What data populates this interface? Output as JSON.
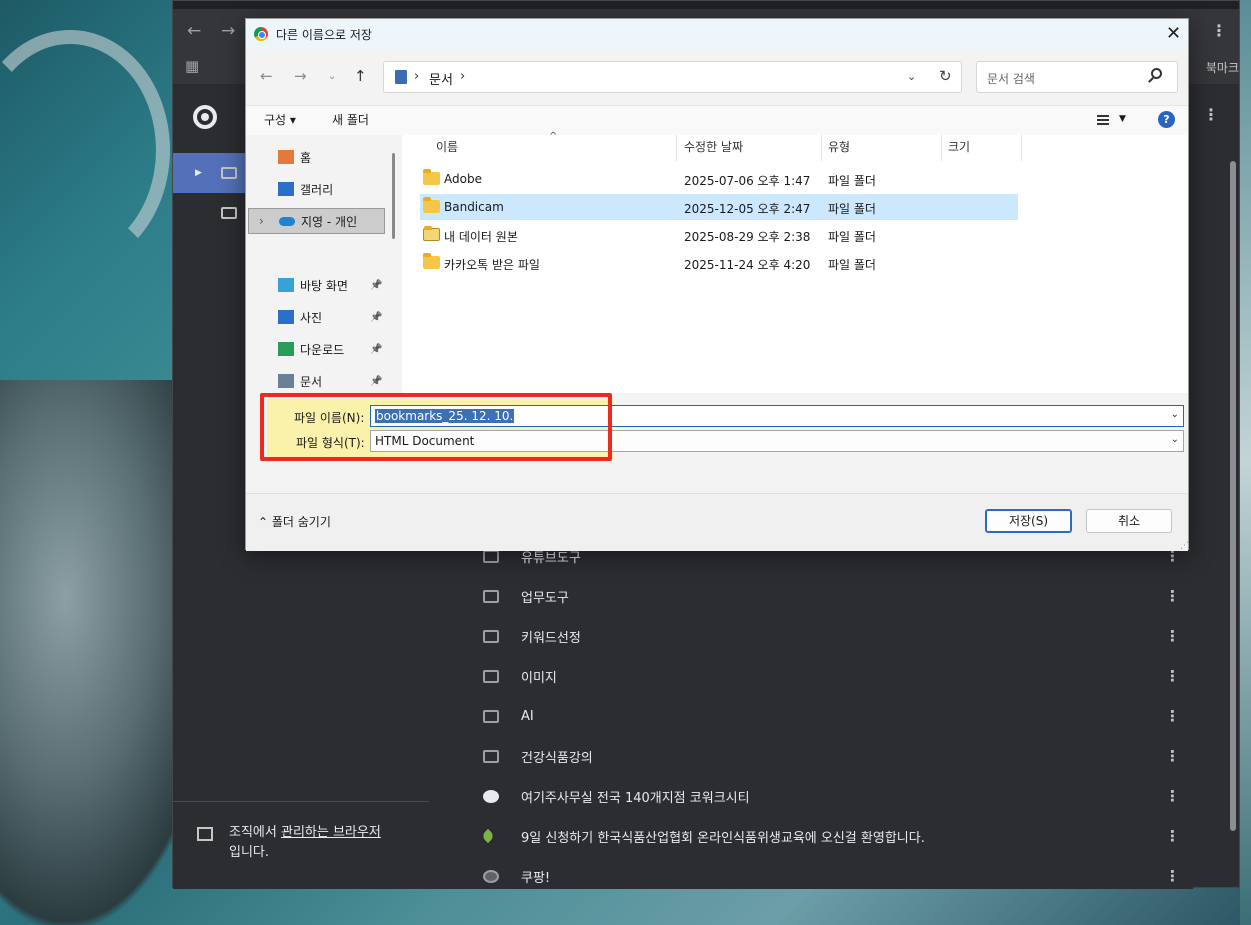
{
  "chrome": {
    "bookmarks_bar_label": "북마크",
    "org_text_prefix": "조직에서 ",
    "org_link": "관리하는 브라우저",
    "org_text_suffix": "입니다.",
    "bookmarks": [
      {
        "label": "유튜브도구",
        "icon": "folder-icon"
      },
      {
        "label": "업무도구",
        "icon": "folder-icon"
      },
      {
        "label": "키워드선정",
        "icon": "folder-icon"
      },
      {
        "label": "이미지",
        "icon": "folder-icon"
      },
      {
        "label": "AI",
        "icon": "folder-icon"
      },
      {
        "label": "건강식품강의",
        "icon": "folder-icon"
      },
      {
        "label": "여기주사무실 전국 140개지점 코워크시티",
        "icon": "site-c-icon"
      },
      {
        "label": "9일 신청하기 한국식품산업협회 온라인식품위생교육에 오신걸 환영합니다.",
        "icon": "leaf-icon"
      },
      {
        "label": "쿠팡!",
        "icon": "globe-icon"
      }
    ]
  },
  "dialog": {
    "title": "다른 이름으로 저장",
    "address": {
      "path_segment": "문서"
    },
    "search_placeholder": "문서 검색",
    "commands": {
      "organize": "구성 ▾",
      "new_folder": "새 폴더"
    },
    "nav": [
      {
        "label": "홈",
        "icon": "home-icon",
        "pinned": false
      },
      {
        "label": "갤러리",
        "icon": "gallery-icon",
        "pinned": false
      },
      {
        "label": "지영 - 개인",
        "icon": "onedrive-icon",
        "pinned": false,
        "selected": true
      },
      {
        "label": "바탕 화면",
        "icon": "desktop-icon",
        "pinned": true
      },
      {
        "label": "사진",
        "icon": "pictures-icon",
        "pinned": true
      },
      {
        "label": "다운로드",
        "icon": "download-icon",
        "pinned": true
      },
      {
        "label": "문서",
        "icon": "documents-icon",
        "pinned": true
      }
    ],
    "columns": {
      "name": "이름",
      "modified": "수정한 날짜",
      "type": "유형",
      "size": "크기"
    },
    "files": [
      {
        "name": "Adobe",
        "modified": "2025-07-06 오후 1:47",
        "type": "파일 폴더",
        "selected": false
      },
      {
        "name": "Bandicam",
        "modified": "2025-12-05 오후 2:47",
        "type": "파일 폴더",
        "selected": true
      },
      {
        "name": "내 데이터 원본",
        "modified": "2025-08-29 오후 2:38",
        "type": "파일 폴더",
        "selected": false
      },
      {
        "name": "카카오톡 받은 파일",
        "modified": "2025-11-24 오후 4:20",
        "type": "파일 폴더",
        "selected": false
      }
    ],
    "filename_label": "파일 이름(N):",
    "filename_value": "bookmarks_25. 12. 10.",
    "filetype_label": "파일 형식(T):",
    "filetype_value": "HTML Document",
    "hide_folders": "⌃ 폴더 숨기기",
    "save_button": "저장(S)",
    "cancel_button": "취소"
  }
}
